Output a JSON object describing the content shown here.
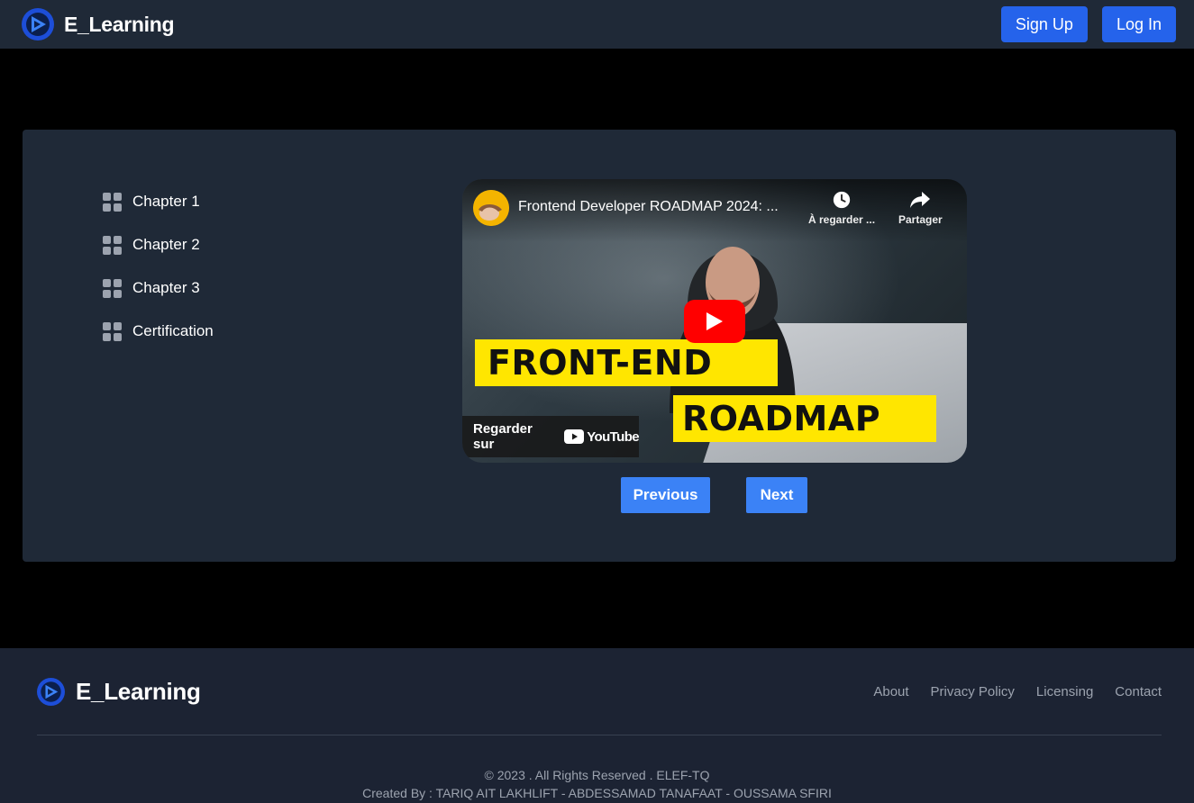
{
  "header": {
    "brand": "E_Learning",
    "signup_label": "Sign Up",
    "login_label": "Log In"
  },
  "sidebar": {
    "items": [
      {
        "label": "Chapter 1"
      },
      {
        "label": "Chapter 2"
      },
      {
        "label": "Chapter 3"
      },
      {
        "label": "Certification"
      }
    ]
  },
  "video": {
    "title": "Frontend Developer ROADMAP 2024: ...",
    "watch_later_label": "À regarder ...",
    "share_label": "Partager",
    "thumbnail_line1": "FRONT-END",
    "thumbnail_line2": "ROADMAP",
    "watch_on_label": "Regarder sur",
    "youtube_word": "YouTube"
  },
  "pager": {
    "previous_label": "Previous",
    "next_label": "Next"
  },
  "footer": {
    "brand": "E_Learning",
    "links": [
      "About",
      "Privacy Policy",
      "Licensing",
      "Contact"
    ],
    "copyright": "© 2023 . All Rights Reserved . ELEF-TQ",
    "credits": "Created By : TARIQ AIT LAKHLIFT - ABDESSAMAD TANAFAAT - OUSSAMA SFIRI"
  },
  "colors": {
    "accent": "#2563eb",
    "button": "#3b82f6",
    "panel": "#1f2937",
    "youtube_red": "#ff0000",
    "highlight_yellow": "#ffe600"
  }
}
